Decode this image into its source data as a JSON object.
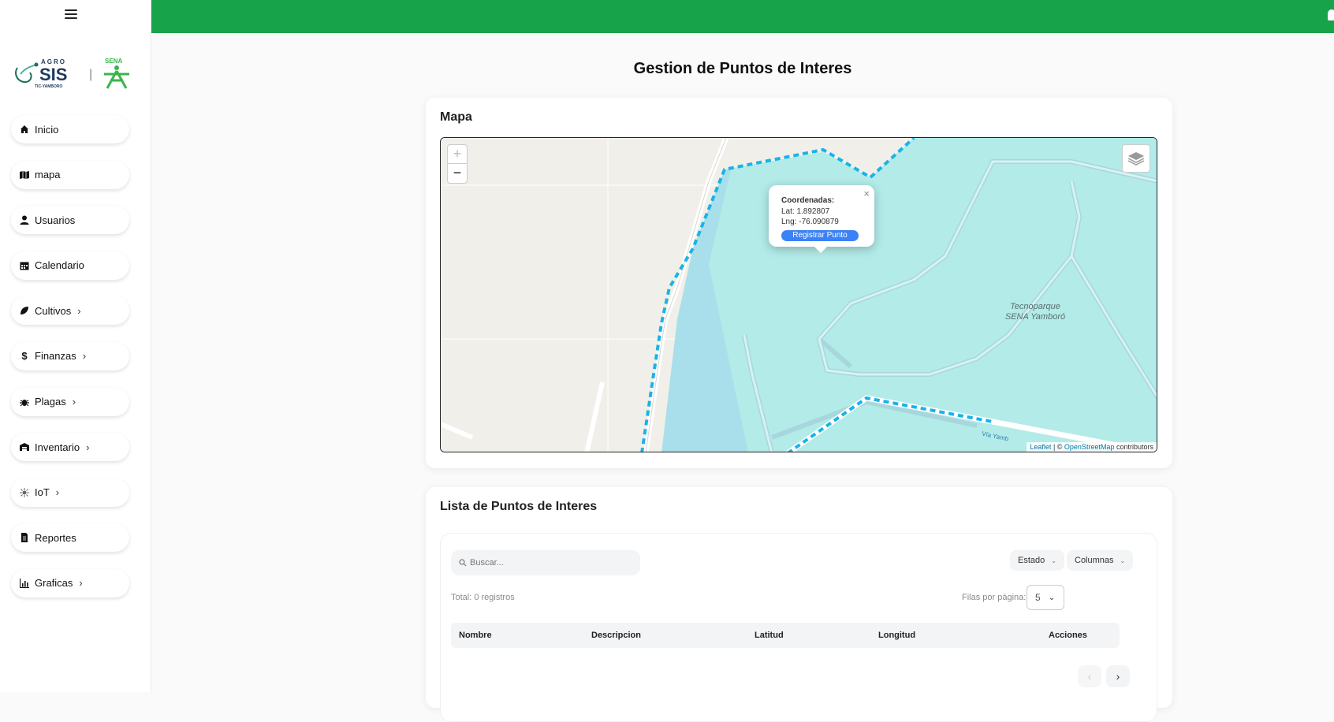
{
  "sidebar": {
    "items": [
      {
        "label": "Inicio",
        "icon": "home-icon",
        "has_submenu": false
      },
      {
        "label": "mapa",
        "icon": "map-icon",
        "has_submenu": false
      },
      {
        "label": "Usuarios",
        "icon": "user-icon",
        "has_submenu": false
      },
      {
        "label": "Calendario",
        "icon": "calendar-icon",
        "has_submenu": false
      },
      {
        "label": "Cultivos",
        "icon": "leaf-icon",
        "has_submenu": true
      },
      {
        "label": "Finanzas",
        "icon": "dollar-icon",
        "has_submenu": true
      },
      {
        "label": "Plagas",
        "icon": "bug-icon",
        "has_submenu": true
      },
      {
        "label": "Inventario",
        "icon": "warehouse-icon",
        "has_submenu": true
      },
      {
        "label": "IoT",
        "icon": "sensor-icon",
        "has_submenu": true
      },
      {
        "label": "Reportes",
        "icon": "file-icon",
        "has_submenu": false
      },
      {
        "label": "Graficas",
        "icon": "chart-icon",
        "has_submenu": true
      }
    ],
    "logo": {
      "agro": "AGRO",
      "sis": "SIS",
      "sub": "TIC-YAMBORO",
      "sena": "SENA"
    }
  },
  "page": {
    "title": "Gestion de Puntos de Interes"
  },
  "map_card": {
    "title": "Mapa",
    "zoom_in": "+",
    "zoom_out": "−",
    "popup": {
      "title": "Coordenadas:",
      "lat": "Lat: 1.892807",
      "lng": "Lng: -76.090879",
      "button": "Registrar Punto",
      "close": "×"
    },
    "place_label_1": "Tecnoparque",
    "place_label_2": "SENA Yamboró",
    "road_label": "Vía Yamb",
    "attribution": {
      "leaflet": "Leaflet",
      "sep": " | © ",
      "osm": "OpenStreetMap",
      "rest": " contributors"
    }
  },
  "list_card": {
    "title": "Lista de Puntos de Interes",
    "search_placeholder": "Buscar...",
    "estado_label": "Estado",
    "columnas_label": "Columnas",
    "total": "Total: 0 registros",
    "rows_label": "Filas por página:",
    "rows_value": "5",
    "columns": [
      "Nombre",
      "Descripcion",
      "Latitud",
      "Longitud",
      "Acciones"
    ],
    "prev": "‹",
    "next": "›"
  },
  "colors": {
    "topbar": "#17a34a",
    "accent": "#3b82f6",
    "map_area": "#b2ebe8",
    "path": "#18b4e8"
  }
}
